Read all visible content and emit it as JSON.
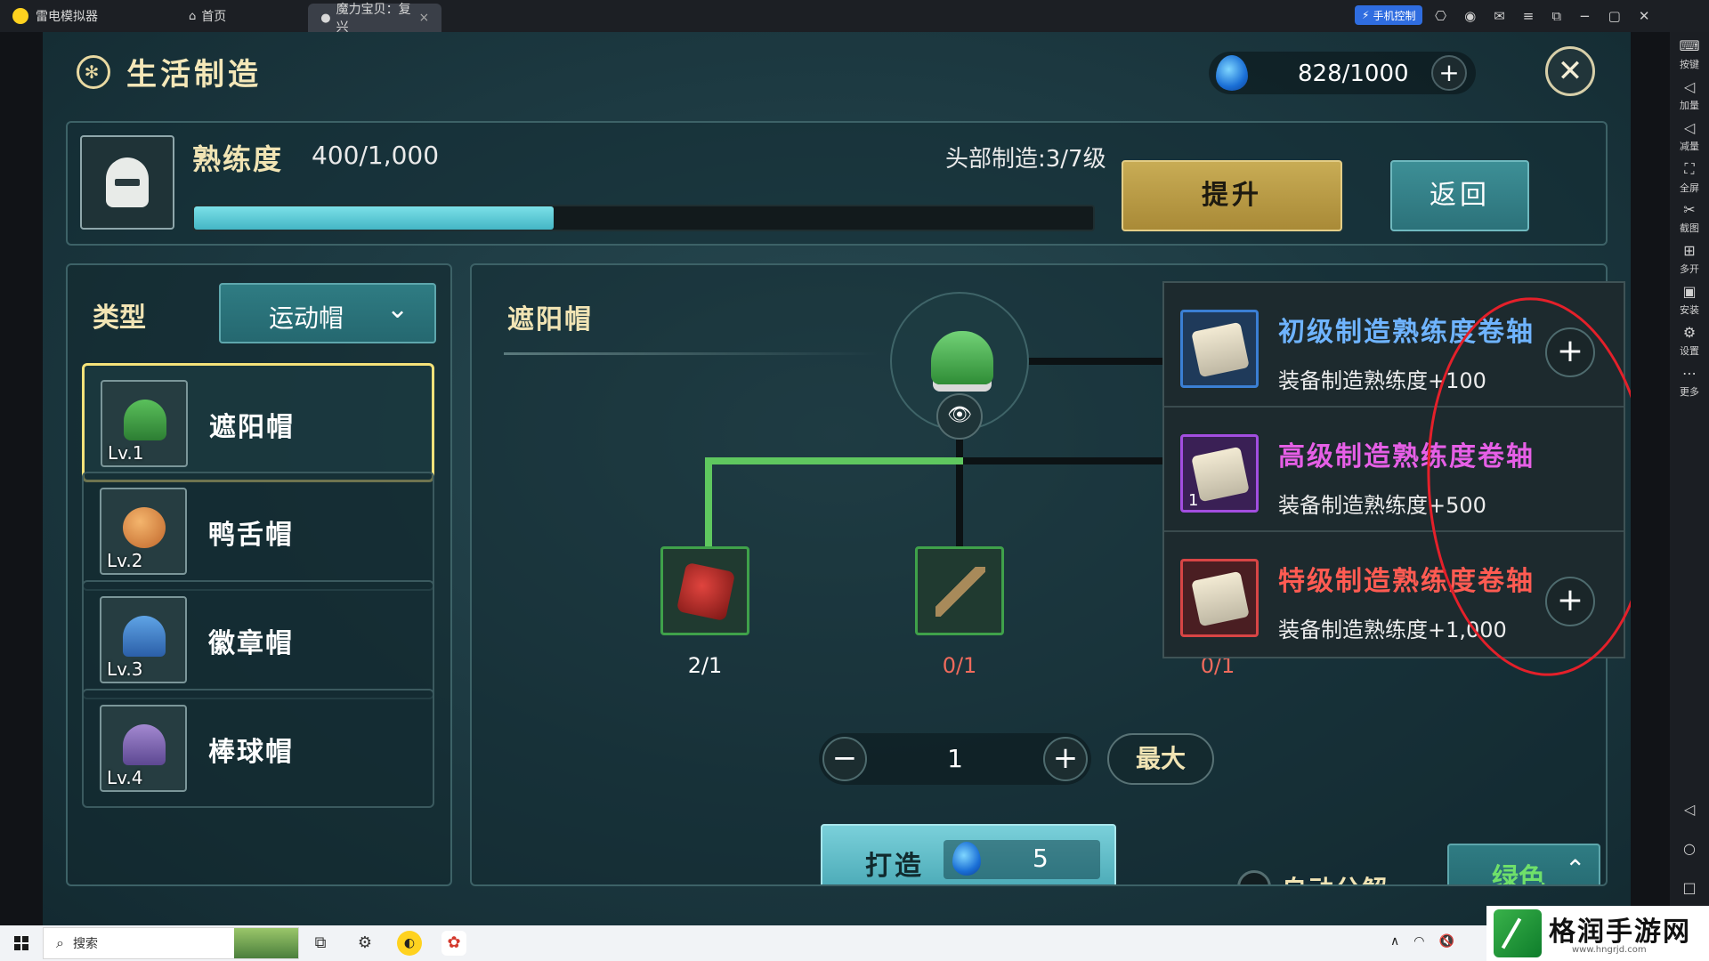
{
  "emulator": {
    "app_name": "雷电模拟器",
    "tabs": [
      {
        "label": "首页"
      },
      {
        "label": "魔力宝贝：复兴"
      }
    ],
    "phone_control": "手机控制",
    "sidebar": [
      {
        "label": "按键",
        "icon": "keyboard-icon"
      },
      {
        "label": "加量",
        "icon": "volume-up-icon"
      },
      {
        "label": "减量",
        "icon": "volume-down-icon"
      },
      {
        "label": "全屏",
        "icon": "fullscreen-icon"
      },
      {
        "label": "截图",
        "icon": "scissors-icon"
      },
      {
        "label": "多开",
        "icon": "multi-instance-icon"
      },
      {
        "label": "安装",
        "icon": "apk-icon"
      },
      {
        "label": "设置",
        "icon": "gear-icon"
      },
      {
        "label": "更多",
        "icon": "more-icon"
      }
    ]
  },
  "header": {
    "title": "生活制造",
    "energy": "828/1000"
  },
  "proficiency": {
    "label": "熟练度",
    "value": "400/1,000",
    "progress": 0.4,
    "head_craft": "头部制造:3/7级",
    "upgrade_label": "提升",
    "back_label": "返回"
  },
  "type_panel": {
    "label": "类型",
    "selected_type": "运动帽",
    "items": [
      {
        "name": "遮阳帽",
        "level": "Lv.1"
      },
      {
        "name": "鸭舌帽",
        "level": "Lv.2"
      },
      {
        "name": "徽章帽",
        "level": "Lv.3"
      },
      {
        "name": "棒球帽",
        "level": "Lv.4"
      }
    ]
  },
  "recipe": {
    "title": "遮阳帽",
    "materials": [
      {
        "count": "2/1",
        "color": "#ffffff"
      },
      {
        "count": "0/1",
        "color": "#f06a5c"
      },
      {
        "count": "0/1",
        "color": "#f06a5c"
      }
    ],
    "quantity": "1",
    "max_label": "最大",
    "craft_label": "打造",
    "craft_cost": "5",
    "auto_decompose_label": "自动分解",
    "quality_label": "绿色"
  },
  "scroll_popup": {
    "items": [
      {
        "name": "初级制造熟练度卷轴",
        "desc": "装备制造熟练度+100",
        "count": "",
        "color": "#6fb4ff"
      },
      {
        "name": "高级制造熟练度卷轴",
        "desc": "装备制造熟练度+500",
        "count": "1",
        "color": "#e65fe6"
      },
      {
        "name": "特级制造熟练度卷轴",
        "desc": "装备制造熟练度+1,000",
        "count": "",
        "color": "#ff5b52"
      }
    ]
  },
  "taskbar": {
    "search_placeholder": "搜索"
  },
  "watermark": {
    "name": "格润手游网",
    "url": "www.hngrjd.com"
  }
}
